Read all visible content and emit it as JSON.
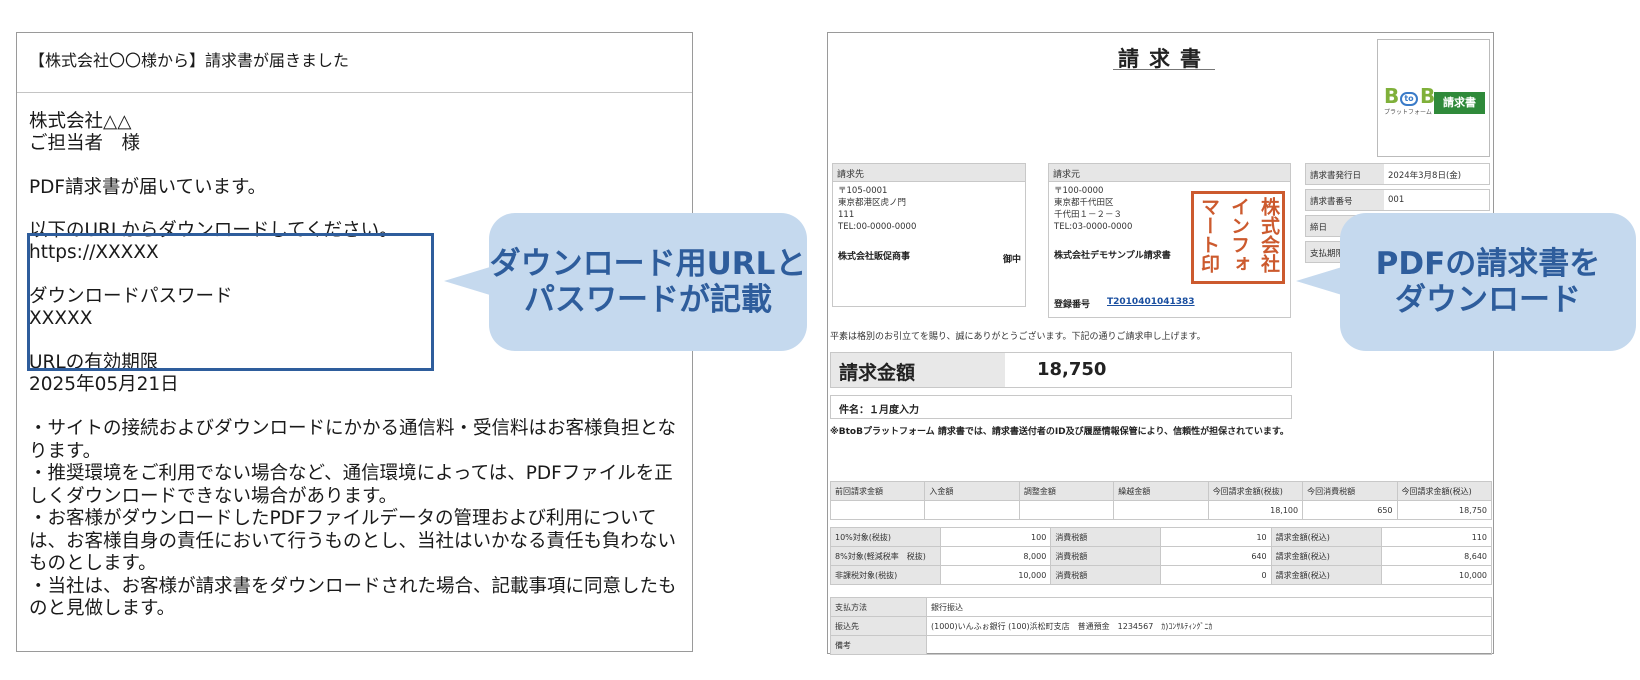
{
  "email": {
    "subject": "【株式会社〇〇様から】請求書が届きました",
    "addressee": "株式会社△△\nご担当者　様",
    "lead": "PDF請求書が届いています。",
    "url_instruction": "以下のURLからダウンロードしてください。",
    "url": "https://XXXXX",
    "password_label": "ダウンロードパスワード",
    "password": "XXXXX",
    "expiry_label": "URLの有効期限",
    "expiry_date": "2025年05月21日",
    "notes": [
      "・サイトの接続およびダウンロードにかかる通信料・受信料はお客様負担となります。",
      "・推奨環境をご利用でない場合など、通信環境によっては、PDFファイルを正しくダウンロードできない場合があります。",
      "・お客様がダウンロードしたPDFファイルデータの管理および利用については、お客様自身の責任において行うものとし、当社はいかなる責任も負わないものとします。",
      "・当社は、お客様が請求書をダウンロードされた場合、記載事項に同意したものと見做します。"
    ]
  },
  "callouts": {
    "left": "ダウンロード用URLと\nパスワードが記載",
    "right": "PDFの請求書を\nダウンロード"
  },
  "colors": {
    "accent_blue": "#2e5d9c",
    "bubble_fill": "#c5d9ee",
    "stamp_red": "#cc5a2e",
    "brand_green": "#2f8a3a"
  },
  "invoice": {
    "title": "請求書",
    "logo": {
      "b1": "B",
      "to": "to",
      "b2": "B",
      "sub": "プラットフォーム",
      "tag": "請求書"
    },
    "bill_to": {
      "header": "請求先",
      "address": "〒105-0001\n東京都港区虎ノ門\n111\nTEL:00-0000-0000",
      "name": "株式会社販促商事",
      "honorific": "御中"
    },
    "bill_from": {
      "header": "請求元",
      "address": "〒100-0000\n東京都千代田区\n千代田１－２－３\nTEL:03-0000-0000",
      "name": "株式会社デモサンプル請求書",
      "registration_label": "登録番号",
      "registration_no": "T2010401041383",
      "stamp_cols": [
        "株式会社",
        "インフォ",
        "マート印"
      ]
    },
    "meta": [
      {
        "key": "請求書発行日",
        "value": "2024年3月8日(金)"
      },
      {
        "key": "請求書番号",
        "value": "001"
      },
      {
        "key": "締日",
        "value": ""
      },
      {
        "key": "支払期限",
        "value": ""
      }
    ],
    "greeting": "平素は格別のお引立てを賜り、誠にありがとうございます。下記の通りご請求申し上げます。",
    "amount_label": "請求金額",
    "amount_value": "18,750",
    "subject": "件名：１月度入力",
    "note": "※BtoBプラットフォーム 請求書では、請求書送付者のID及び履歴情報保管により、信頼性が担保されています。",
    "summary": {
      "headers": [
        "前回請求金額",
        "入金額",
        "調整金額",
        "繰越金額",
        "今回請求金額(税抜)",
        "今回消費税額",
        "今回請求金額(税込)"
      ],
      "values": [
        "",
        "",
        "",
        "",
        "18,100",
        "650",
        "18,750"
      ]
    },
    "tax_rows": [
      [
        "10%対象(税抜)",
        "100",
        "消費税額",
        "10",
        "請求金額(税込)",
        "110"
      ],
      [
        "8%対象(軽減税率　税抜)",
        "8,000",
        "消費税額",
        "640",
        "請求金額(税込)",
        "8,640"
      ],
      [
        "非課税対象(税抜)",
        "10,000",
        "消費税額",
        "0",
        "請求金額(税込)",
        "10,000"
      ]
    ],
    "payment": [
      {
        "key": "支払方法",
        "value": "銀行振込"
      },
      {
        "key": "振込先",
        "value": "(1000)いんふぉ銀行 (100)浜松町支店　普通預金　1234567　ｶ)ｺﾝｻﾙﾃｨﾝｸﾞﾆｶ"
      },
      {
        "key": "備考",
        "value": ""
      }
    ]
  }
}
